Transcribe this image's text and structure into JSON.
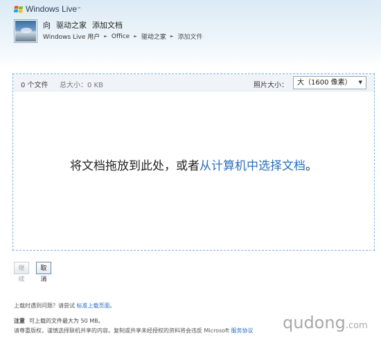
{
  "header": {
    "brand": "Windows Live",
    "brand_tm": "™",
    "title_prefix": "向",
    "folder_name": "驱动之家",
    "action": "添加文档"
  },
  "breadcrumb": {
    "items": [
      "Windows Live 用户",
      "Office",
      "驱动之家"
    ],
    "current": "添加文件",
    "separator": "►"
  },
  "dropzone": {
    "file_count": "0 个文件",
    "total_size": "总大小：0 KB",
    "photo_size_label": "照片大小：",
    "photo_size_value": "大（1600 像素）",
    "drop_text": "将文档拖放到此处，或者",
    "select_link": "从计算机中选择文档",
    "drop_text_end": "。"
  },
  "buttons": {
    "continue": "继续",
    "cancel": "取消"
  },
  "footer": {
    "help_text": "上载时遇到问题？请尝试",
    "help_link": "标准上载页面。",
    "notice_label": "注意",
    "notice_text": "可上载的文件最大为 50 MB。",
    "legal_text": "请尊重版权，谨慎选择联机共享的内容。复制或共享未经授权的资料将会违反 Microsoft",
    "legal_link": "服务协议"
  },
  "watermark": {
    "main": "qudong",
    "suffix": ".com"
  },
  "colors": {
    "link": "#2a6fbf",
    "dropzone_border": "#7fb0e0"
  }
}
